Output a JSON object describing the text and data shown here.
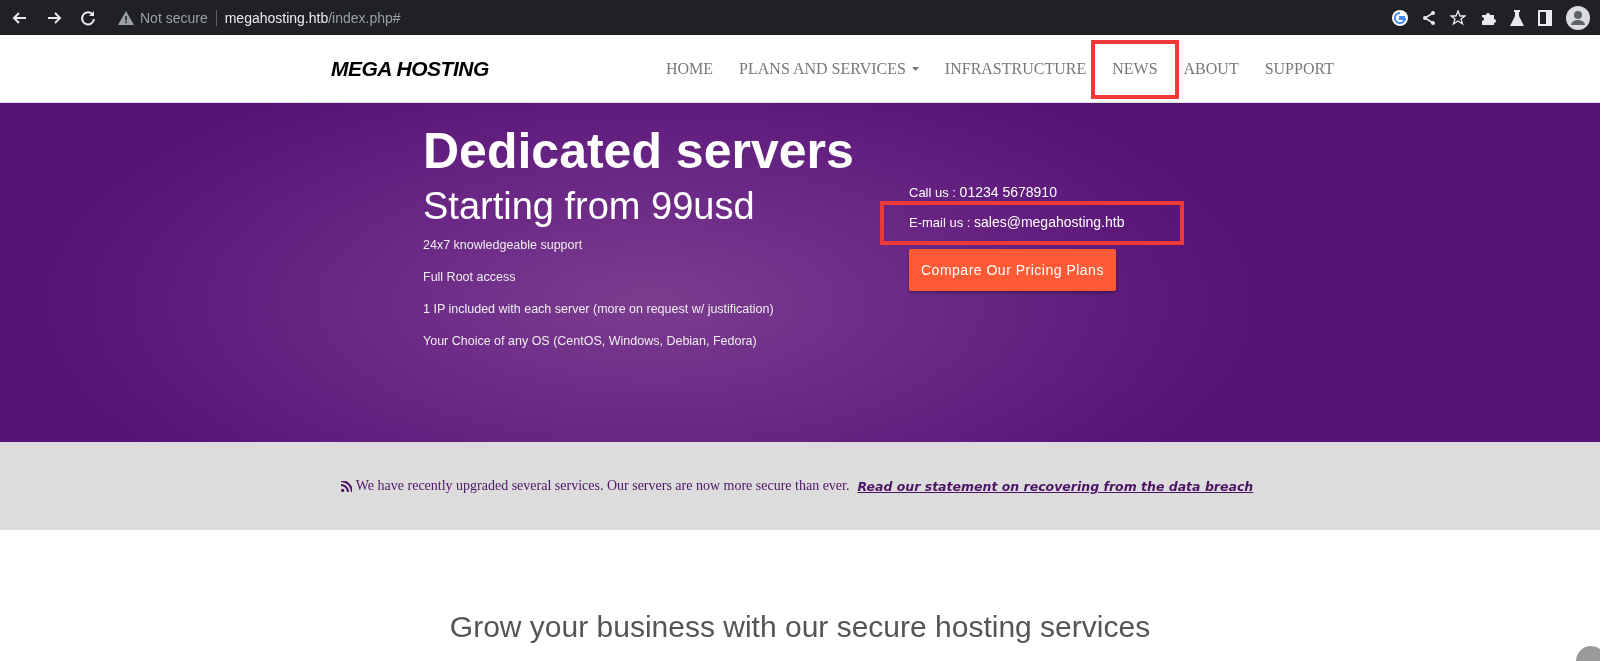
{
  "browser": {
    "security": "Not secure",
    "url_host": "megahosting.htb",
    "url_path": "/index.php#"
  },
  "site": {
    "logo": "MEGA HOSTING",
    "nav": [
      {
        "label": "HOME",
        "dropdown": false,
        "highlighted": false
      },
      {
        "label": "PLANS AND SERVICES",
        "dropdown": true,
        "highlighted": false
      },
      {
        "label": "INFRASTRUCTURE",
        "dropdown": false,
        "highlighted": false
      },
      {
        "label": "NEWS",
        "dropdown": false,
        "highlighted": true
      },
      {
        "label": "ABOUT",
        "dropdown": false,
        "highlighted": false
      },
      {
        "label": "SUPPORT",
        "dropdown": false,
        "highlighted": false
      }
    ]
  },
  "hero": {
    "title": "Dedicated servers",
    "subtitle": "Starting from 99usd",
    "features": [
      "24x7 knowledgeable support",
      "Full Root access",
      "1 IP included with each server (more on request w/ justification)",
      "Your Choice of any OS (CentOS, Windows, Debian, Fedora)"
    ],
    "contacts": [
      {
        "label": "Call us :",
        "value": "01234 5678910",
        "highlighted": false
      },
      {
        "label": "E-mail us :",
        "value": "sales@megahosting.htb",
        "highlighted": true
      }
    ],
    "button": "Compare Our Pricing Plans"
  },
  "notice": {
    "text": "We have recently upgraded several services. Our servers are now more secure than ever.",
    "link": "Read our statement on recovering from the data breach"
  },
  "section": {
    "heading": "Grow your business with our secure hosting services"
  }
}
